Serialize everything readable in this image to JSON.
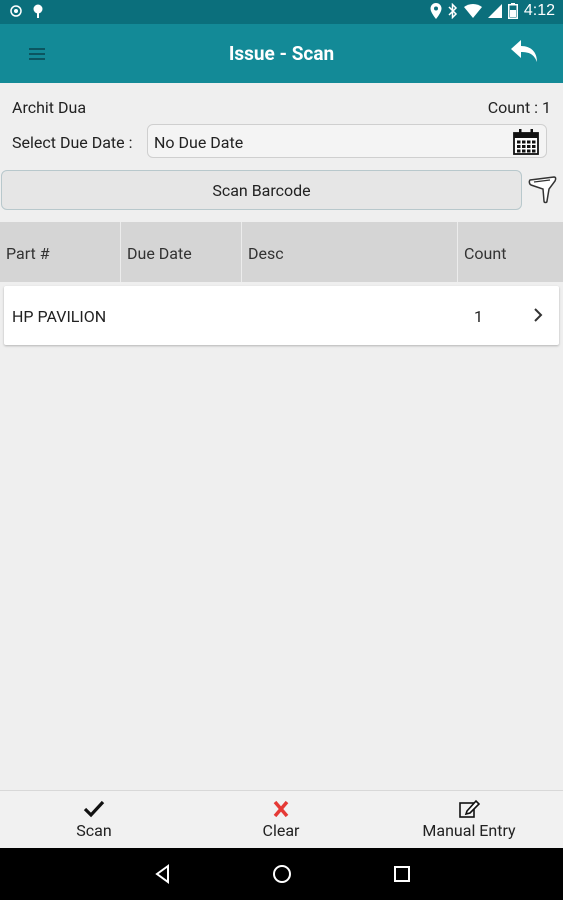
{
  "status_bar": {
    "time": "4:12"
  },
  "app_bar": {
    "title": "Issue - Scan"
  },
  "header": {
    "user_name": "Archit Dua",
    "count_label": "Count : 1"
  },
  "due_date": {
    "label": "Select Due Date :",
    "value": "No Due Date"
  },
  "scan_button": {
    "label": "Scan Barcode"
  },
  "table": {
    "columns": [
      "Part #",
      "Due Date",
      "Desc",
      "Count"
    ],
    "rows": [
      {
        "part": "HP PAVILION",
        "due_date": "",
        "desc": "",
        "count": "1"
      }
    ]
  },
  "bottom_bar": {
    "scan_label": "Scan",
    "clear_label": "Clear",
    "manual_label": "Manual Entry"
  },
  "colors": {
    "status_bar": "#0b6f7c",
    "app_bar": "#138a97",
    "clear_icon": "#e53935"
  }
}
